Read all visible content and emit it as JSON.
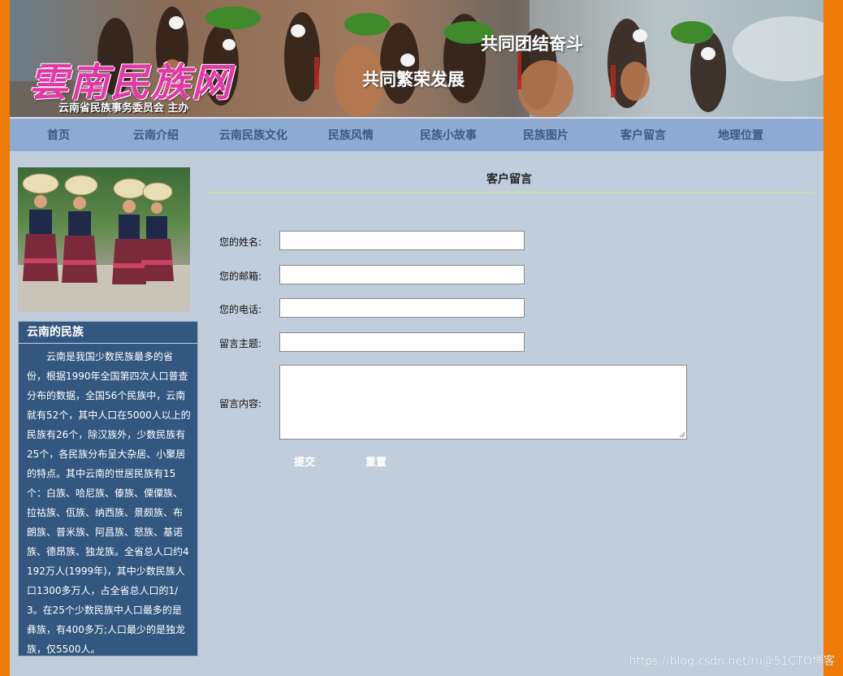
{
  "header": {
    "logo_text": "雲南民族网",
    "sponsor": "云南省民族事务委员会 主办",
    "slogan_1": "共同团结奋斗",
    "slogan_2": "共同繁荣发展"
  },
  "nav": {
    "items": [
      {
        "label": "首页"
      },
      {
        "label": "云南介绍"
      },
      {
        "label": "云南民族文化"
      },
      {
        "label": "民族风情"
      },
      {
        "label": "民族小故事"
      },
      {
        "label": "民族图片"
      },
      {
        "label": "客户留言"
      },
      {
        "label": "地理位置"
      }
    ]
  },
  "sidebar": {
    "box_title": "云南的民族",
    "box_text": "云南是我国少数民族最多的省份，根据1990年全国第四次人口普查分布的数据，全国56个民族中，云南就有52个，其中人口在5000人以上的民族有26个，除汉族外，少数民族有25个，各民族分布呈大杂居、小聚居的特点。其中云南的世居民族有15个：白族、哈尼族、傣族、傈僳族、拉祜族、佤族、纳西族、景颇族、布朗族、普米族、阿昌族、怒族、基诺族、德昂族、独龙族。全省总人口约4192万人(1999年)，其中少数民族人口1300多万人，占全省总人口的1/3。在25个少数民族中人口最多的是彝族，有400多万;人口最少的是独龙族，仅5500人。"
  },
  "form": {
    "heading": "客户留言",
    "name_label": "您的姓名:",
    "email_label": "您的邮箱:",
    "phone_label": "您的电话:",
    "subject_label": "留言主题:",
    "content_label": "留言内容:",
    "name_value": "",
    "email_value": "",
    "phone_value": "",
    "subject_value": "",
    "content_value": "",
    "submit_label": "提交",
    "reset_label": "重置"
  },
  "watermark": "https://blog.csdn.net/ru@51CTO博客",
  "colors": {
    "outer_background": "#ee7b08",
    "page_background": "#c1cddb",
    "nav_background": "#8eaad0",
    "nav_text": "#3d5a84",
    "sidebar_box": "#33577f",
    "logo_text": "#e03aa6",
    "heading_rule": "#e6e27a"
  }
}
